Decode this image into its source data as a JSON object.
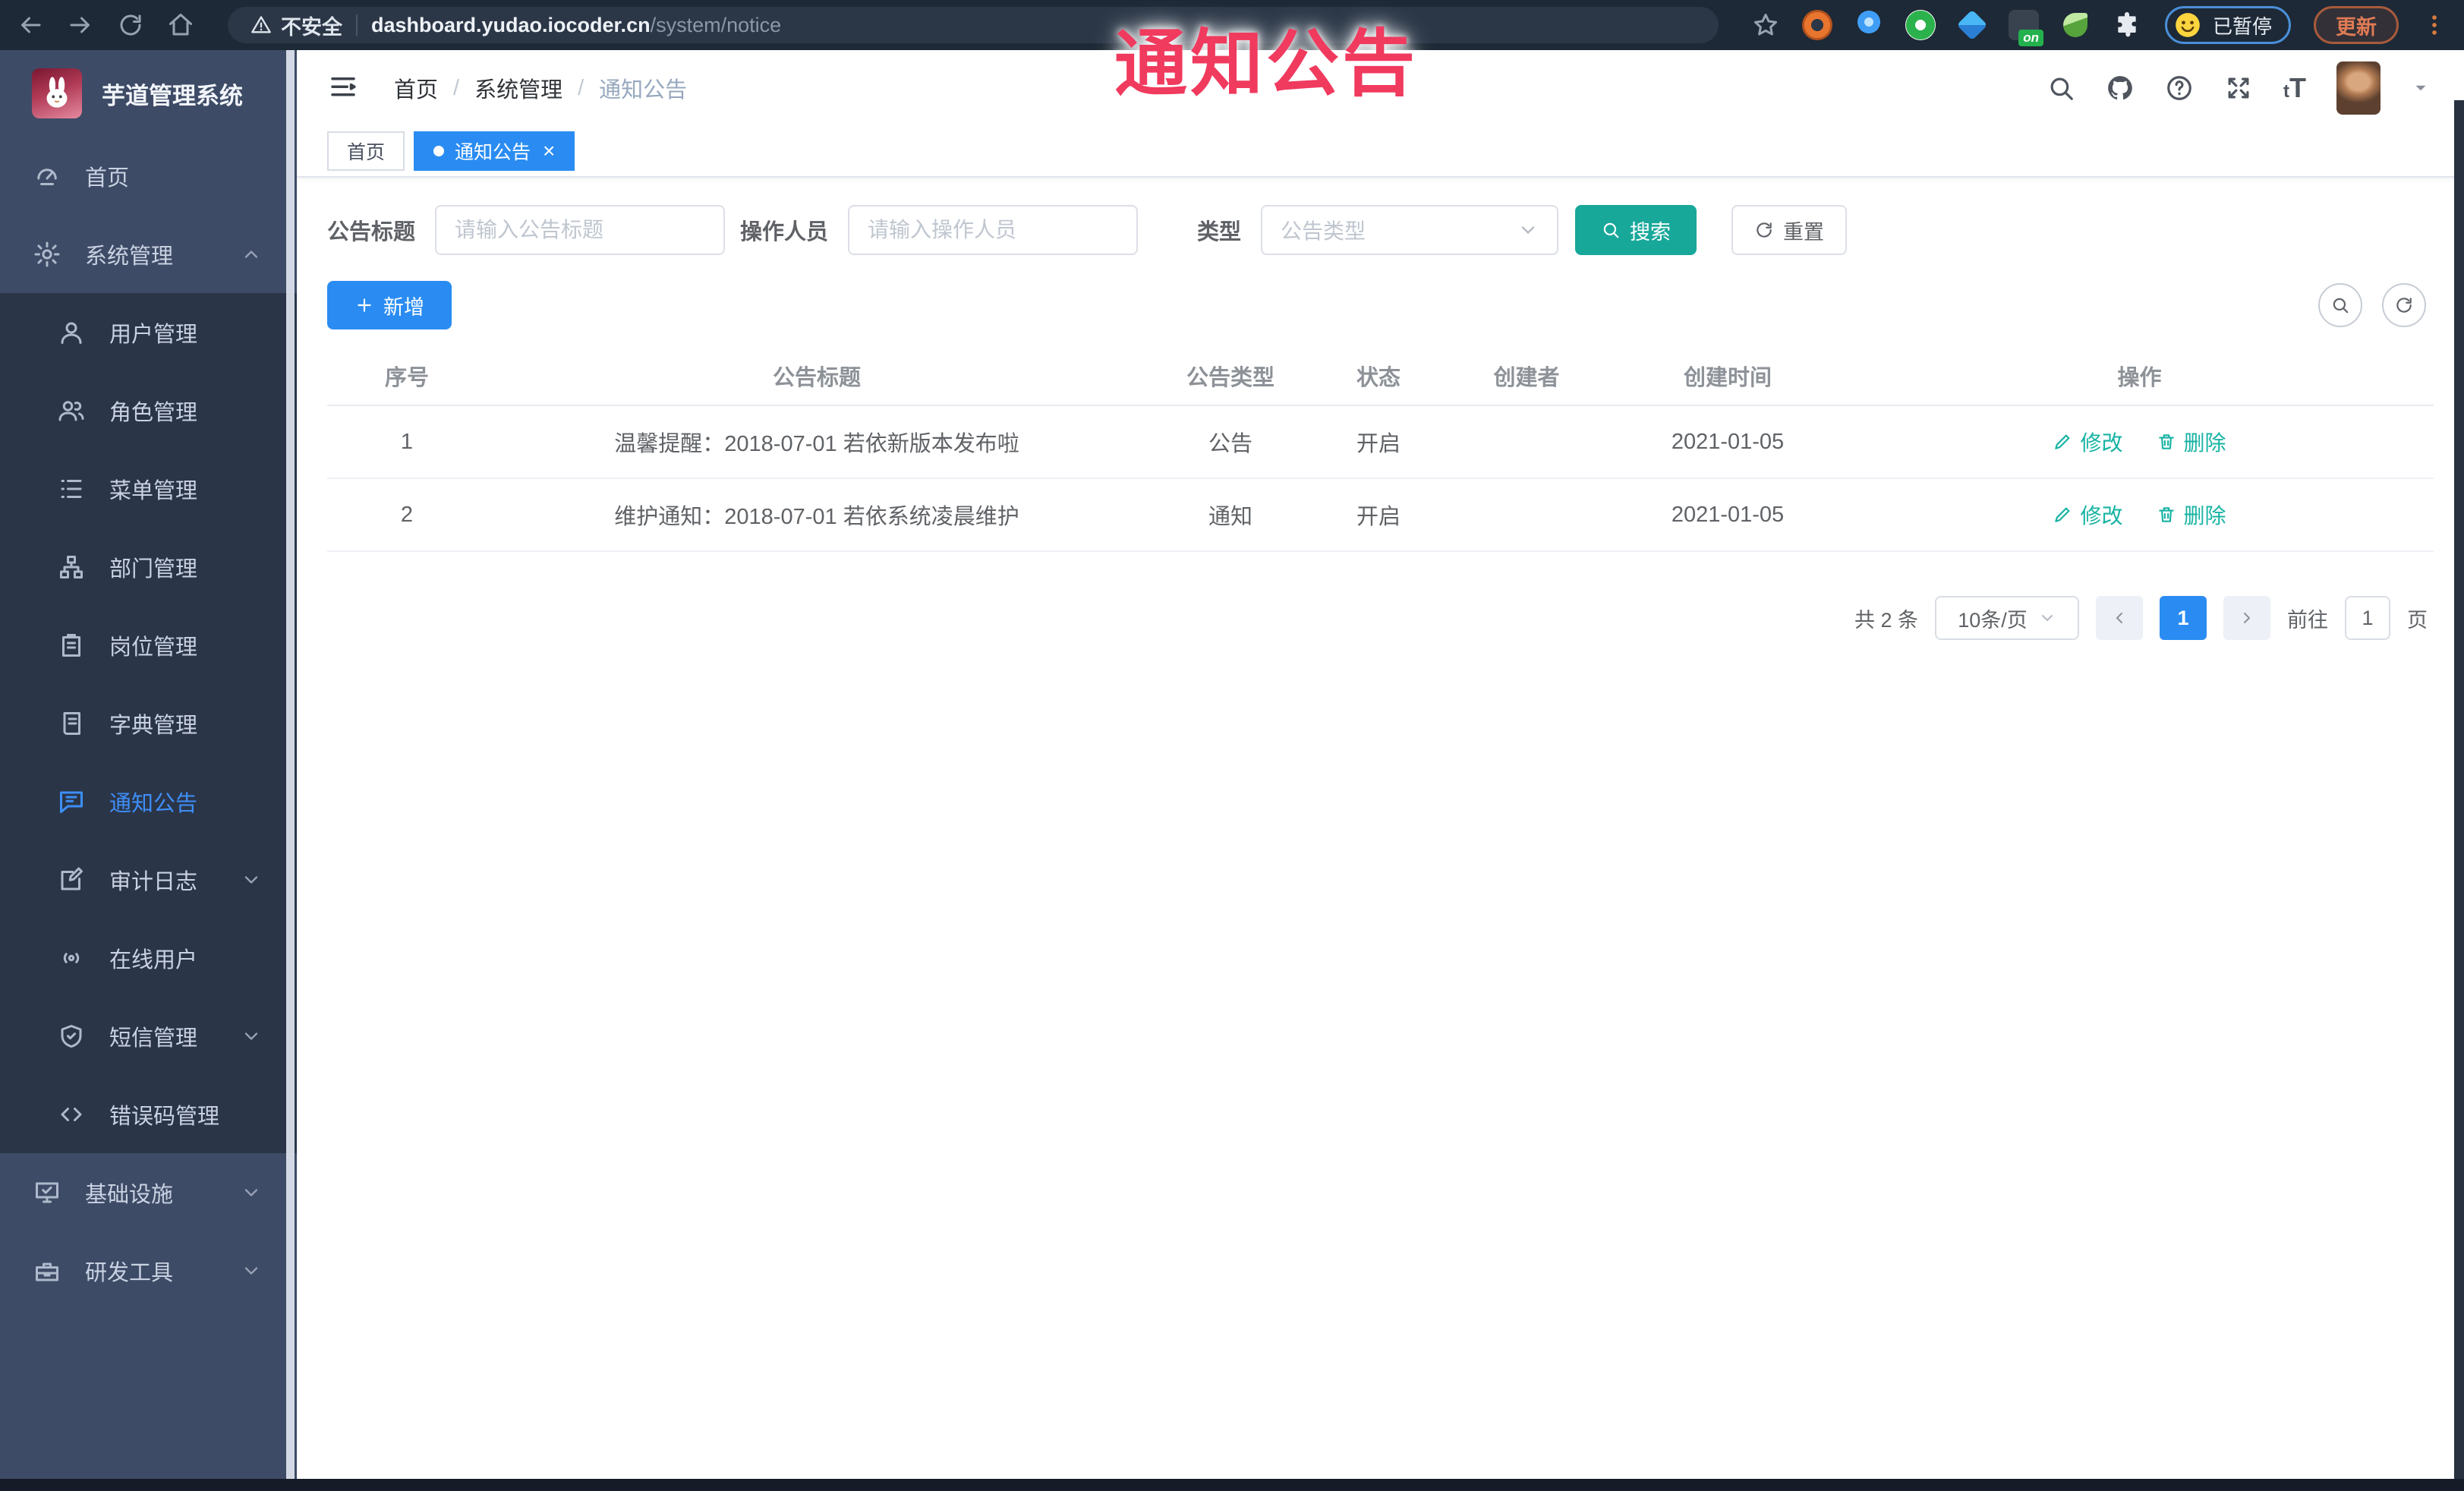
{
  "browser": {
    "security_label": "不安全",
    "url_domain": "dashboard.yudao.iocoder.cn",
    "url_path": "/system/notice",
    "extensions": [
      {
        "name": "extension-orange-ring-icon"
      },
      {
        "name": "extension-blue-drop-icon"
      },
      {
        "name": "extension-green-circle-icon"
      },
      {
        "name": "extension-blue-diamond-icon"
      },
      {
        "name": "extension-dark-icon",
        "badge": "on"
      },
      {
        "name": "extension-green-leaf-icon"
      },
      {
        "name": "extensions-puzzle-icon"
      }
    ],
    "profile_label": "已暂停",
    "update_label": "更新"
  },
  "annotation": {
    "text": "通知公告"
  },
  "sidebar": {
    "logo_title": "芋道管理系统",
    "items": [
      {
        "label": "首页",
        "icon": "dashboard-icon",
        "level": 1
      },
      {
        "label": "系统管理",
        "icon": "gear-icon",
        "level": 1,
        "chevron": "up"
      },
      {
        "label": "用户管理",
        "icon": "user-icon",
        "level": 2
      },
      {
        "label": "角色管理",
        "icon": "users-icon",
        "level": 2
      },
      {
        "label": "菜单管理",
        "icon": "menu-list-icon",
        "level": 2
      },
      {
        "label": "部门管理",
        "icon": "org-tree-icon",
        "level": 2
      },
      {
        "label": "岗位管理",
        "icon": "badge-icon",
        "level": 2
      },
      {
        "label": "字典管理",
        "icon": "dictionary-icon",
        "level": 2
      },
      {
        "label": "通知公告",
        "icon": "announcement-icon",
        "level": 2,
        "active": true
      },
      {
        "label": "审计日志",
        "icon": "audit-log-icon",
        "level": 2,
        "chevron": "down"
      },
      {
        "label": "在线用户",
        "icon": "online-users-icon",
        "level": 2
      },
      {
        "label": "短信管理",
        "icon": "sms-shield-icon",
        "level": 2,
        "chevron": "down"
      },
      {
        "label": "错误码管理",
        "icon": "error-code-icon",
        "level": 2
      },
      {
        "label": "基础设施",
        "icon": "infrastructure-icon",
        "level": 1,
        "chevron": "down"
      },
      {
        "label": "研发工具",
        "icon": "dev-tools-icon",
        "level": 1,
        "chevron": "down"
      }
    ]
  },
  "header": {
    "breadcrumb": [
      {
        "label": "首页"
      },
      {
        "label": "系统管理"
      },
      {
        "label": "通知公告",
        "current": true
      }
    ]
  },
  "tabs": [
    {
      "label": "首页",
      "active": false
    },
    {
      "label": "通知公告",
      "active": true
    }
  ],
  "filters": {
    "title_label": "公告标题",
    "title_placeholder": "请输入公告标题",
    "operator_label": "操作人员",
    "operator_placeholder": "请输入操作人员",
    "type_label": "类型",
    "type_placeholder": "公告类型",
    "search_label": "搜索",
    "reset_label": "重置"
  },
  "toolbar": {
    "add_label": "新增"
  },
  "table": {
    "headers": [
      "序号",
      "公告标题",
      "公告类型",
      "状态",
      "创建者",
      "创建时间",
      "操作"
    ],
    "rows": [
      {
        "no": "1",
        "title": "温馨提醒：2018-07-01 若依新版本发布啦",
        "type": "公告",
        "status": "开启",
        "creator": "",
        "created": "2021-01-05"
      },
      {
        "no": "2",
        "title": "维护通知：2018-07-01 若依系统凌晨维护",
        "type": "通知",
        "status": "开启",
        "creator": "",
        "created": "2021-01-05"
      }
    ],
    "edit_label": "修改",
    "delete_label": "删除"
  },
  "pagination": {
    "total_label": "共 2 条",
    "page_size": "10条/页",
    "current_page": "1",
    "goto_label": "前往",
    "goto_value": "1",
    "page_unit_label": "页"
  },
  "colors": {
    "accent_blue": "#2a8cf2",
    "teal": "#18a89a",
    "action_link": "#17b3a3",
    "annotation_red": "#f03a5e",
    "topbar_bg": "#1d2936",
    "sidebar_bg": "#3e4b66",
    "sidebar_submenu_bg": "#2a3548",
    "sidebar_active": "#3e8ef7",
    "update_orange": "#e07b54"
  }
}
